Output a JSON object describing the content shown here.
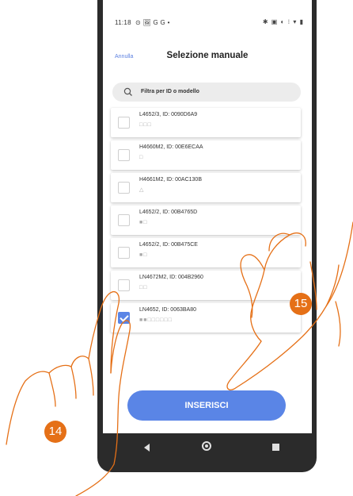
{
  "status_bar": {
    "time": "11:18",
    "left_icons": "⊙ 🖼 G G •",
    "right_icons": "✱ ▣ ◐ ⁝ ▾ ▮"
  },
  "window_corner": {
    "resize_icon": "⇱",
    "close_icon": "✕"
  },
  "header": {
    "cancel_label": "Annulla",
    "title": "Selezione manuale"
  },
  "search": {
    "placeholder": "Filtra per ID o modello"
  },
  "devices": [
    {
      "name": "L4652/3, ID: 0090D6A9",
      "squares": "□□□",
      "checked": false
    },
    {
      "name": "H4660M2, ID: 00E6ECAA",
      "squares": "□",
      "checked": false
    },
    {
      "name": "H4661M2, ID: 00AC130B",
      "squares": "△",
      "checked": false
    },
    {
      "name": "L4652/2, ID: 00B4765D",
      "squares": "■□",
      "checked": false
    },
    {
      "name": "L4652/2, ID: 00B475CE",
      "squares": "■□",
      "checked": false
    },
    {
      "name": "LN4672M2, ID: 004B2960",
      "squares": "□□",
      "checked": false
    },
    {
      "name": "LN4652, ID: 0063BA80",
      "squares": "■■□□□□□□",
      "checked": true
    }
  ],
  "insert_button_label": "INSERISCI",
  "step_badges": {
    "left": "14",
    "right": "15"
  },
  "colors": {
    "accent": "#5a85e6",
    "badge": "#e57017",
    "hand_outline": "#e57017"
  }
}
